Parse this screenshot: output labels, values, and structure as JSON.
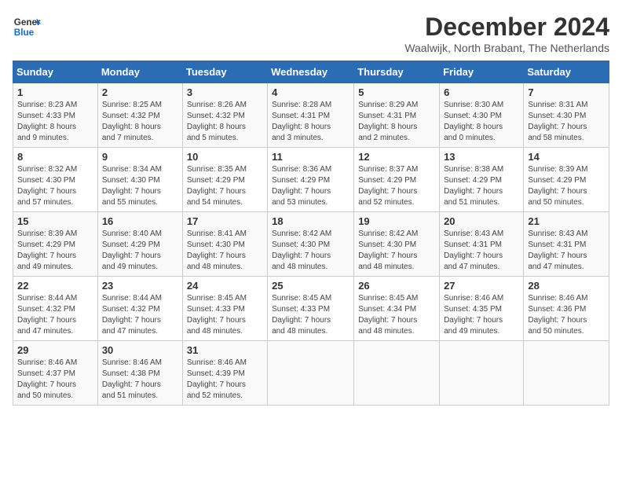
{
  "header": {
    "logo_line1": "General",
    "logo_line2": "Blue",
    "main_title": "December 2024",
    "subtitle": "Waalwijk, North Brabant, The Netherlands"
  },
  "calendar": {
    "headers": [
      "Sunday",
      "Monday",
      "Tuesday",
      "Wednesday",
      "Thursday",
      "Friday",
      "Saturday"
    ],
    "weeks": [
      [
        {
          "day": "",
          "info": ""
        },
        {
          "day": "2",
          "info": "Sunrise: 8:25 AM\nSunset: 4:32 PM\nDaylight: 8 hours\nand 7 minutes."
        },
        {
          "day": "3",
          "info": "Sunrise: 8:26 AM\nSunset: 4:32 PM\nDaylight: 8 hours\nand 5 minutes."
        },
        {
          "day": "4",
          "info": "Sunrise: 8:28 AM\nSunset: 4:31 PM\nDaylight: 8 hours\nand 3 minutes."
        },
        {
          "day": "5",
          "info": "Sunrise: 8:29 AM\nSunset: 4:31 PM\nDaylight: 8 hours\nand 2 minutes."
        },
        {
          "day": "6",
          "info": "Sunrise: 8:30 AM\nSunset: 4:30 PM\nDaylight: 8 hours\nand 0 minutes."
        },
        {
          "day": "7",
          "info": "Sunrise: 8:31 AM\nSunset: 4:30 PM\nDaylight: 7 hours\nand 58 minutes."
        }
      ],
      [
        {
          "day": "1",
          "info": "Sunrise: 8:23 AM\nSunset: 4:33 PM\nDaylight: 8 hours\nand 9 minutes."
        },
        {
          "day": "",
          "info": ""
        },
        {
          "day": "",
          "info": ""
        },
        {
          "day": "",
          "info": ""
        },
        {
          "day": "",
          "info": ""
        },
        {
          "day": "",
          "info": ""
        },
        {
          "day": "",
          "info": ""
        }
      ],
      [
        {
          "day": "8",
          "info": "Sunrise: 8:32 AM\nSunset: 4:30 PM\nDaylight: 7 hours\nand 57 minutes."
        },
        {
          "day": "9",
          "info": "Sunrise: 8:34 AM\nSunset: 4:30 PM\nDaylight: 7 hours\nand 55 minutes."
        },
        {
          "day": "10",
          "info": "Sunrise: 8:35 AM\nSunset: 4:29 PM\nDaylight: 7 hours\nand 54 minutes."
        },
        {
          "day": "11",
          "info": "Sunrise: 8:36 AM\nSunset: 4:29 PM\nDaylight: 7 hours\nand 53 minutes."
        },
        {
          "day": "12",
          "info": "Sunrise: 8:37 AM\nSunset: 4:29 PM\nDaylight: 7 hours\nand 52 minutes."
        },
        {
          "day": "13",
          "info": "Sunrise: 8:38 AM\nSunset: 4:29 PM\nDaylight: 7 hours\nand 51 minutes."
        },
        {
          "day": "14",
          "info": "Sunrise: 8:39 AM\nSunset: 4:29 PM\nDaylight: 7 hours\nand 50 minutes."
        }
      ],
      [
        {
          "day": "15",
          "info": "Sunrise: 8:39 AM\nSunset: 4:29 PM\nDaylight: 7 hours\nand 49 minutes."
        },
        {
          "day": "16",
          "info": "Sunrise: 8:40 AM\nSunset: 4:29 PM\nDaylight: 7 hours\nand 49 minutes."
        },
        {
          "day": "17",
          "info": "Sunrise: 8:41 AM\nSunset: 4:30 PM\nDaylight: 7 hours\nand 48 minutes."
        },
        {
          "day": "18",
          "info": "Sunrise: 8:42 AM\nSunset: 4:30 PM\nDaylight: 7 hours\nand 48 minutes."
        },
        {
          "day": "19",
          "info": "Sunrise: 8:42 AM\nSunset: 4:30 PM\nDaylight: 7 hours\nand 48 minutes."
        },
        {
          "day": "20",
          "info": "Sunrise: 8:43 AM\nSunset: 4:31 PM\nDaylight: 7 hours\nand 47 minutes."
        },
        {
          "day": "21",
          "info": "Sunrise: 8:43 AM\nSunset: 4:31 PM\nDaylight: 7 hours\nand 47 minutes."
        }
      ],
      [
        {
          "day": "22",
          "info": "Sunrise: 8:44 AM\nSunset: 4:32 PM\nDaylight: 7 hours\nand 47 minutes."
        },
        {
          "day": "23",
          "info": "Sunrise: 8:44 AM\nSunset: 4:32 PM\nDaylight: 7 hours\nand 47 minutes."
        },
        {
          "day": "24",
          "info": "Sunrise: 8:45 AM\nSunset: 4:33 PM\nDaylight: 7 hours\nand 48 minutes."
        },
        {
          "day": "25",
          "info": "Sunrise: 8:45 AM\nSunset: 4:33 PM\nDaylight: 7 hours\nand 48 minutes."
        },
        {
          "day": "26",
          "info": "Sunrise: 8:45 AM\nSunset: 4:34 PM\nDaylight: 7 hours\nand 48 minutes."
        },
        {
          "day": "27",
          "info": "Sunrise: 8:46 AM\nSunset: 4:35 PM\nDaylight: 7 hours\nand 49 minutes."
        },
        {
          "day": "28",
          "info": "Sunrise: 8:46 AM\nSunset: 4:36 PM\nDaylight: 7 hours\nand 50 minutes."
        }
      ],
      [
        {
          "day": "29",
          "info": "Sunrise: 8:46 AM\nSunset: 4:37 PM\nDaylight: 7 hours\nand 50 minutes."
        },
        {
          "day": "30",
          "info": "Sunrise: 8:46 AM\nSunset: 4:38 PM\nDaylight: 7 hours\nand 51 minutes."
        },
        {
          "day": "31",
          "info": "Sunrise: 8:46 AM\nSunset: 4:39 PM\nDaylight: 7 hours\nand 52 minutes."
        },
        {
          "day": "",
          "info": ""
        },
        {
          "day": "",
          "info": ""
        },
        {
          "day": "",
          "info": ""
        },
        {
          "day": "",
          "info": ""
        }
      ]
    ]
  }
}
